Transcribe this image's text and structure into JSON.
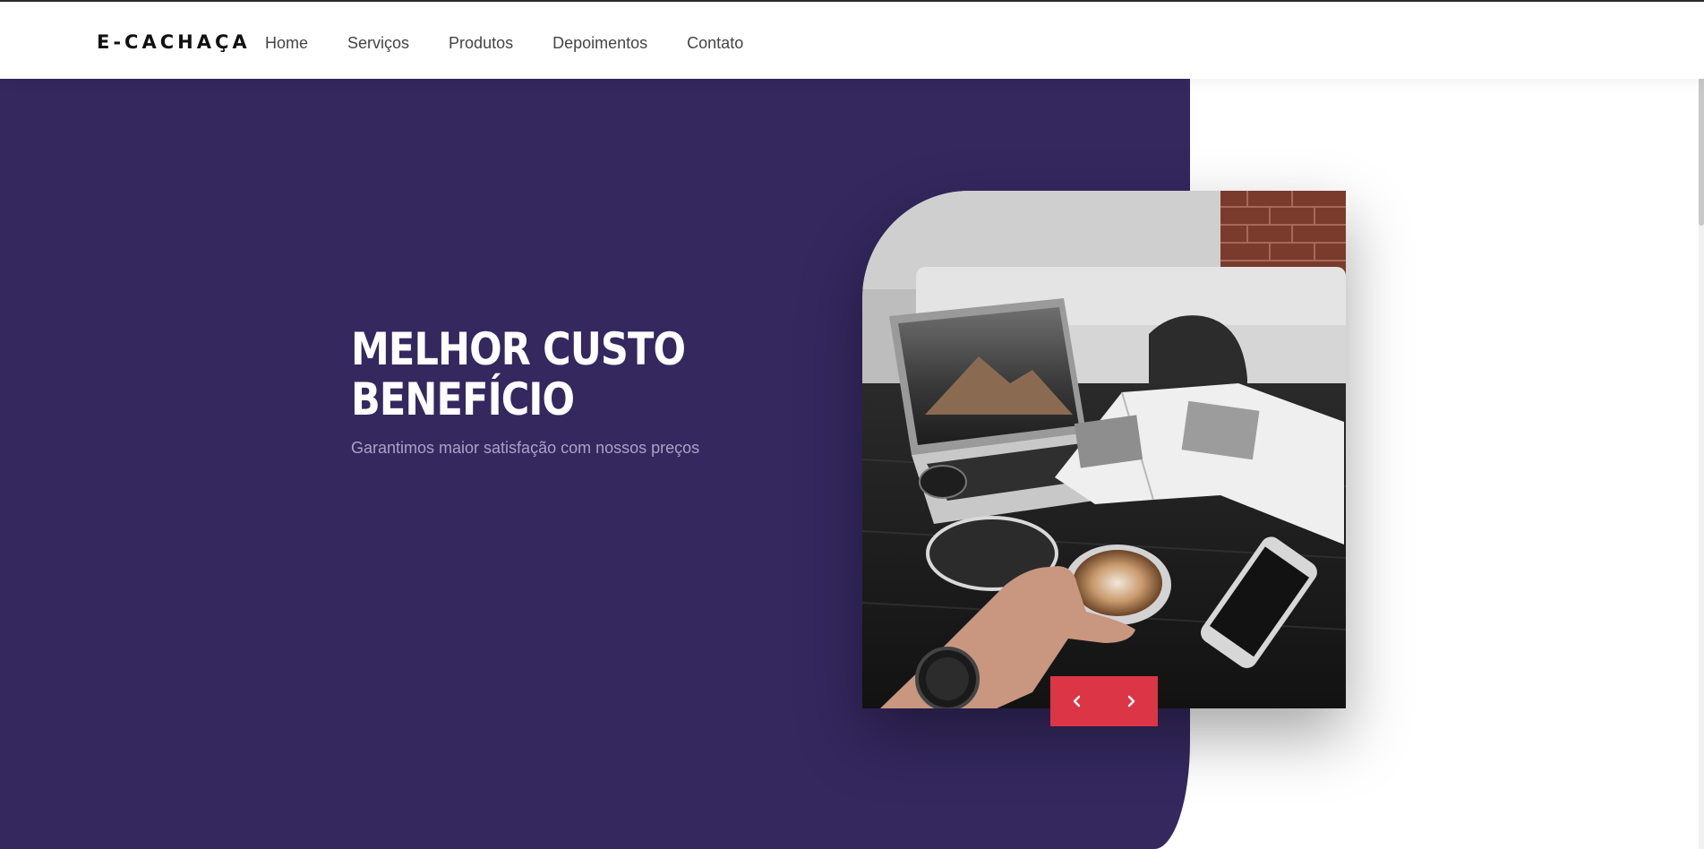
{
  "brand": {
    "name": "E-CACHAÇA"
  },
  "nav": {
    "items": [
      {
        "label": "Home"
      },
      {
        "label": "Serviços"
      },
      {
        "label": "Produtos"
      },
      {
        "label": "Depoimentos"
      },
      {
        "label": "Contato"
      }
    ]
  },
  "hero": {
    "title_line1": "MELHOR CUSTO",
    "title_line2": "BENEFÍCIO",
    "subtitle": "Garantimos maior satisfação com nossos preços"
  },
  "slider": {
    "prev_icon": "chevron-left-icon",
    "next_icon": "chevron-right-icon"
  },
  "colors": {
    "hero_background": "#34285f",
    "accent": "#dc3545",
    "subtitle": "#a9a3c6"
  }
}
